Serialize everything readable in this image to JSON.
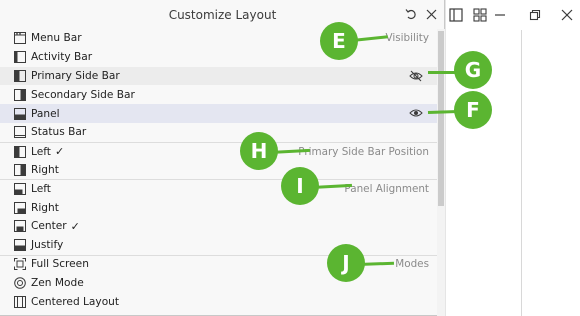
{
  "panel": {
    "title": "Customize Layout"
  },
  "sections": {
    "visibility": "Visibility",
    "primary_position": "Primary Side Bar Position",
    "panel_alignment": "Panel Alignment",
    "modes": "Modes"
  },
  "items": {
    "menu_bar": "Menu Bar",
    "activity_bar": "Activity Bar",
    "primary_side_bar": "Primary Side Bar",
    "secondary_side_bar": "Secondary Side Bar",
    "panel": "Panel",
    "status_bar": "Status Bar",
    "pos_left": "Left",
    "pos_right": "Right",
    "align_left": "Left",
    "align_right": "Right",
    "align_center": "Center",
    "align_justify": "Justify",
    "full_screen": "Full Screen",
    "zen_mode": "Zen Mode",
    "centered_layout": "Centered Layout"
  },
  "checkmark": "✓",
  "callouts": {
    "e": "E",
    "f": "F",
    "g": "G",
    "h": "H",
    "i": "I",
    "j": "J"
  },
  "colors": {
    "callout": "#5bb531",
    "highlight": "#ececec",
    "selected": "#e4e6f1"
  },
  "icons": {
    "reset": "undo-icon",
    "close": "close-icon",
    "hidden": "eye-closed-icon",
    "visible": "eye-icon"
  }
}
